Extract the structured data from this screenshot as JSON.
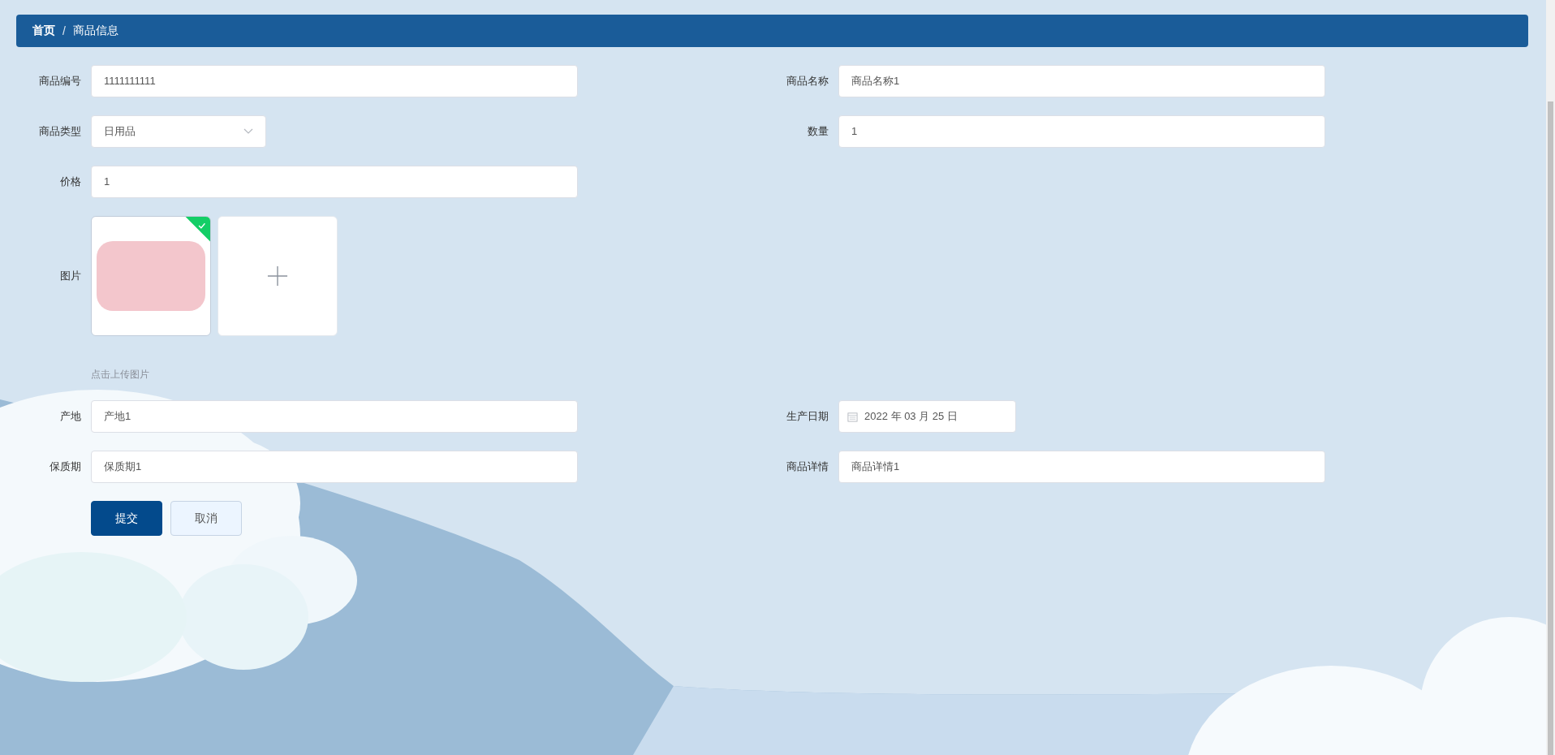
{
  "breadcrumb": [
    {
      "label": "首页"
    },
    {
      "label": "商品信息"
    }
  ],
  "breadcrumb_separator": "/",
  "form": {
    "rows": [
      [
        {
          "kind": "text",
          "label": "商品编号",
          "value": "1111111111"
        },
        {
          "kind": "text",
          "label": "商品名称",
          "value": "商品名称1"
        }
      ],
      [
        {
          "kind": "select",
          "label": "商品类型",
          "value": "日用品"
        },
        {
          "kind": "text",
          "label": "数量",
          "value": "1"
        }
      ],
      [
        {
          "kind": "text",
          "label": "价格",
          "value": "1"
        }
      ],
      [
        {
          "kind": "upload",
          "label": "图片",
          "files": [
            {
              "uploaded": true
            }
          ],
          "hint": "点击上传图片"
        }
      ],
      [
        {
          "kind": "text",
          "label": "产地",
          "value": "产地1"
        },
        {
          "kind": "date",
          "label": "生产日期",
          "value": "2022 年 03 月 25 日"
        }
      ],
      [
        {
          "kind": "text",
          "label": "保质期",
          "value": "保质期1"
        },
        {
          "kind": "text",
          "label": "商品详情",
          "value": "商品详情1"
        }
      ]
    ],
    "buttons": [
      {
        "kind": "primary",
        "label": "提交"
      },
      {
        "kind": "default",
        "label": "取消"
      }
    ]
  }
}
